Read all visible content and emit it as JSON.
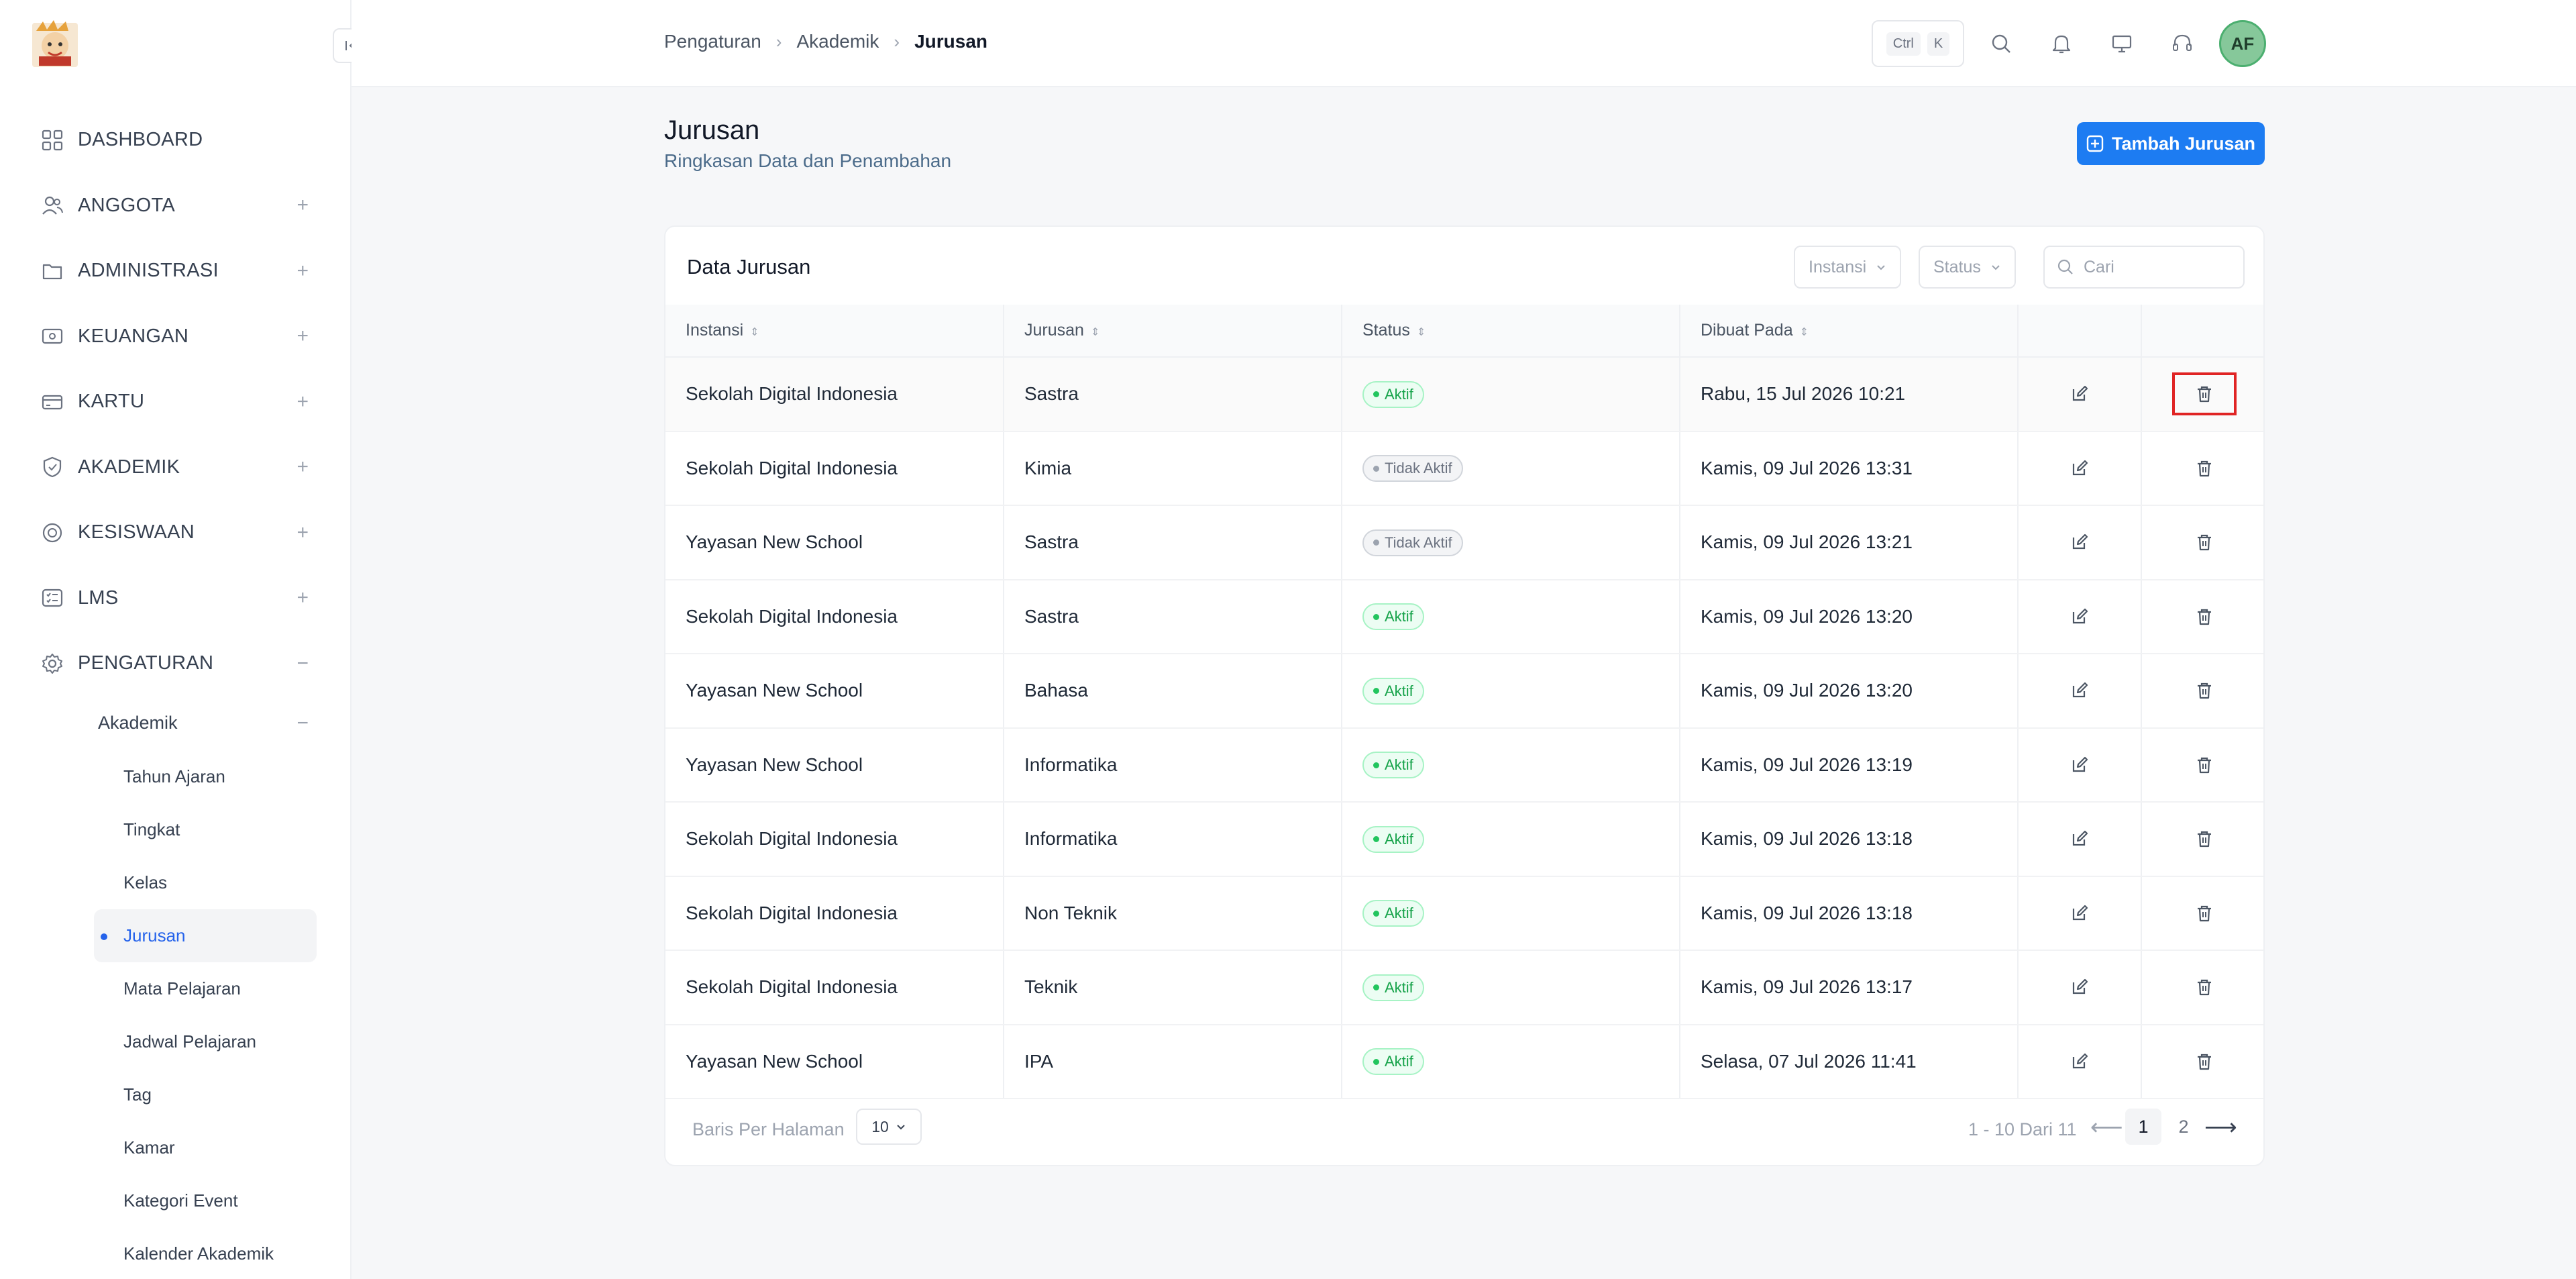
{
  "brand": {
    "logo_icon": "mascot-logo-icon"
  },
  "sidebar": {
    "items": [
      {
        "label": "DASHBOARD",
        "icon": "grid-icon",
        "toggle": ""
      },
      {
        "label": "ANGGOTA",
        "icon": "users-icon",
        "toggle": "+"
      },
      {
        "label": "ADMINISTRASI",
        "icon": "folder-icon",
        "toggle": "+"
      },
      {
        "label": "KEUANGAN",
        "icon": "wallet-icon",
        "toggle": "+"
      },
      {
        "label": "KARTU",
        "icon": "card-icon",
        "toggle": "+"
      },
      {
        "label": "AKADEMIK",
        "icon": "shield-icon",
        "toggle": "+"
      },
      {
        "label": "KESISWAAN",
        "icon": "badge-icon",
        "toggle": "+"
      },
      {
        "label": "LMS",
        "icon": "checklist-icon",
        "toggle": "+"
      },
      {
        "label": "PENGATURAN",
        "icon": "gear-icon",
        "toggle": "−"
      }
    ],
    "akademik": {
      "label": "Akademik",
      "toggle": "−"
    },
    "sub_items": [
      "Tahun Ajaran",
      "Tingkat",
      "Kelas",
      "Jurusan",
      "Mata Pelajaran",
      "Jadwal Pelajaran",
      "Tag",
      "Kamar",
      "Kategori Event",
      "Kalender Akademik"
    ],
    "active_sub": "Jurusan"
  },
  "topbar": {
    "breadcrumb": [
      "Pengaturan",
      "Akademik",
      "Jurusan"
    ],
    "shortcut": {
      "ctrl": "Ctrl",
      "key": "K"
    },
    "avatar_initials": "AF"
  },
  "page": {
    "title": "Jurusan",
    "subtitle": "Ringkasan Data dan Penambahan",
    "add_button": "Tambah Jurusan"
  },
  "card": {
    "title": "Data Jurusan",
    "filters": {
      "instansi": "Instansi",
      "status": "Status"
    },
    "search_placeholder": "Cari"
  },
  "table": {
    "headers": {
      "instansi": "Instansi",
      "jurusan": "Jurusan",
      "status": "Status",
      "dibuat": "Dibuat Pada"
    },
    "rows": [
      {
        "instansi": "Sekolah Digital Indonesia",
        "jurusan": "Sastra",
        "status": "Aktif",
        "dibuat": "Rabu, 15 Jul 2026 10:21"
      },
      {
        "instansi": "Sekolah Digital Indonesia",
        "jurusan": "Kimia",
        "status": "Tidak Aktif",
        "dibuat": "Kamis, 09 Jul 2026 13:31"
      },
      {
        "instansi": "Yayasan New School",
        "jurusan": "Sastra",
        "status": "Tidak Aktif",
        "dibuat": "Kamis, 09 Jul 2026 13:21"
      },
      {
        "instansi": "Sekolah Digital Indonesia",
        "jurusan": "Sastra",
        "status": "Aktif",
        "dibuat": "Kamis, 09 Jul 2026 13:20"
      },
      {
        "instansi": "Yayasan New School",
        "jurusan": "Bahasa",
        "status": "Aktif",
        "dibuat": "Kamis, 09 Jul 2026 13:20"
      },
      {
        "instansi": "Yayasan New School",
        "jurusan": "Informatika",
        "status": "Aktif",
        "dibuat": "Kamis, 09 Jul 2026 13:19"
      },
      {
        "instansi": "Sekolah Digital Indonesia",
        "jurusan": "Informatika",
        "status": "Aktif",
        "dibuat": "Kamis, 09 Jul 2026 13:18"
      },
      {
        "instansi": "Sekolah Digital Indonesia",
        "jurusan": "Non Teknik",
        "status": "Aktif",
        "dibuat": "Kamis, 09 Jul 2026 13:18"
      },
      {
        "instansi": "Sekolah Digital Indonesia",
        "jurusan": "Teknik",
        "status": "Aktif",
        "dibuat": "Kamis, 09 Jul 2026 13:17"
      },
      {
        "instansi": "Yayasan New School",
        "jurusan": "IPA",
        "status": "Aktif",
        "dibuat": "Selasa, 07 Jul 2026 11:41"
      }
    ]
  },
  "footer": {
    "rows_label": "Baris Per Halaman",
    "rows_value": "10",
    "range": "1 - 10 Dari 11",
    "pages": [
      "1",
      "2"
    ],
    "current_page": "1"
  },
  "colors": {
    "primary": "#1d7cf2",
    "active_green": "#16a34a",
    "highlight": "#e02424"
  }
}
